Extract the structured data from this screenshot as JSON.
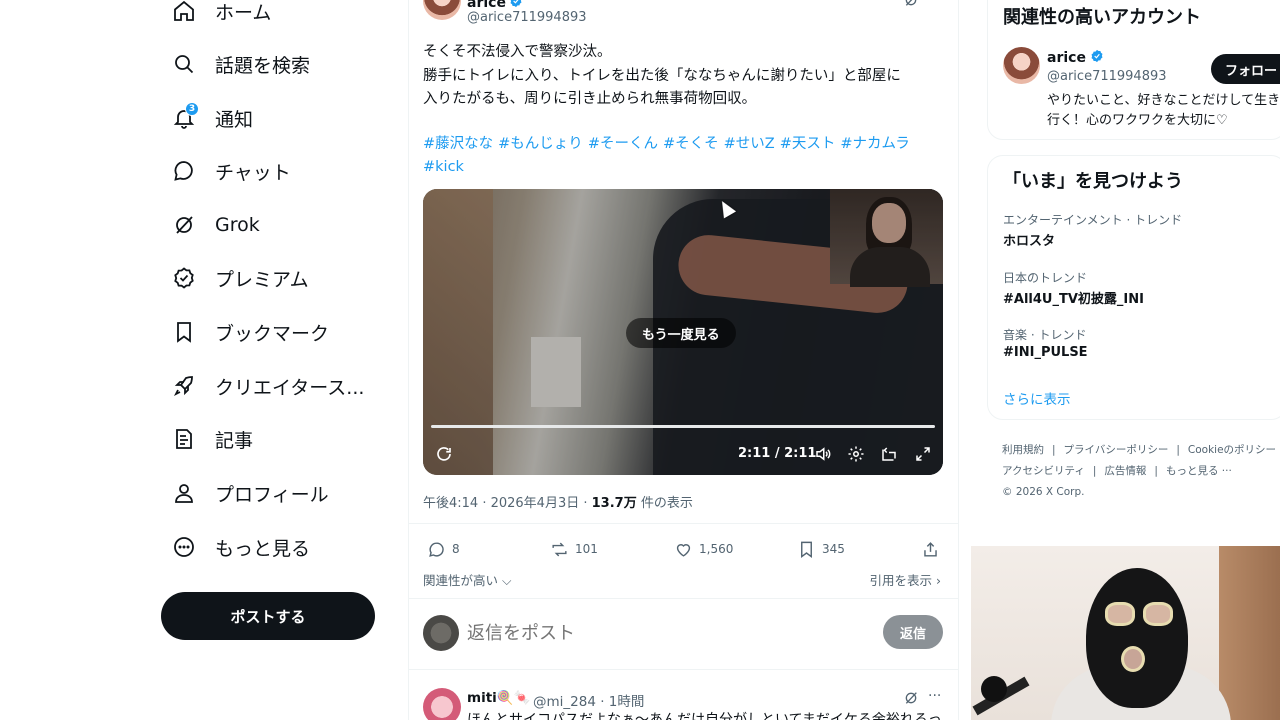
{
  "nav": {
    "items": [
      {
        "label": "ホーム",
        "icon": "home-icon"
      },
      {
        "label": "話題を検索",
        "icon": "search-icon"
      },
      {
        "label": "通知",
        "icon": "bell-icon",
        "badge": "3"
      },
      {
        "label": "チャット",
        "icon": "chat-icon"
      },
      {
        "label": "Grok",
        "icon": "grok-icon"
      },
      {
        "label": "プレミアム",
        "icon": "verified-icon"
      },
      {
        "label": "ブックマーク",
        "icon": "bookmark-icon"
      },
      {
        "label": "クリエイタース...",
        "icon": "rocket-icon"
      },
      {
        "label": "記事",
        "icon": "article-icon"
      },
      {
        "label": "プロフィール",
        "icon": "person-icon"
      },
      {
        "label": "もっと見る",
        "icon": "more-circle-icon"
      }
    ],
    "post_label": "ポストする"
  },
  "tweet": {
    "author_name": "arice",
    "author_handle": "@arice711994893",
    "text_lines": [
      "そくそ不法侵入で警察沙汰。",
      "勝手にトイレに入り、トイレを出た後「ななちゃんに謝りたい」と部屋に",
      "入りたがるも、周りに引き止められ無事荷物回収。"
    ],
    "hashtags": [
      "#藤沢なな",
      "#もんじょり",
      "#そーくん",
      "#そくそ",
      "#せいZ",
      "#天スト",
      "#ナカムラ",
      "#kick"
    ],
    "video": {
      "replay_label": "もう一度見る",
      "time": "2:11 / 2:11",
      "progress": 1.0
    },
    "meta_time": "午後4:14 · 2026年4月3日 · ",
    "views_count": "13.7万",
    "views_label": " 件の表示",
    "stats": {
      "replies": "8",
      "reposts": "101",
      "likes": "1,560",
      "bookmarks": "345"
    },
    "sort_label": "関連性が高い",
    "quotes_label": "引用を表示"
  },
  "reply_box": {
    "placeholder": "返信をポスト",
    "button_label": "返信"
  },
  "reply_tweet": {
    "name": "miti🍭🍬",
    "meta": "@mi_284 · 1時間",
    "text": "ほんとサイコパスだよなぁ〜あんだけ自分がしといてまだイケる余裕れるっ"
  },
  "sidebar": {
    "related_title": "関連性の高いアカウント",
    "suggestion": {
      "name": "arice",
      "handle": "@arice711994893",
      "follow_label": "フォロー",
      "bio": "やりたいこと、好きなことだけして生きて行く！心のワクワクを大切に♡"
    },
    "trends_title": "「いま」を見つけよう",
    "trends": [
      {
        "category": "エンターテインメント · トレンド",
        "name": "ホロスタ"
      },
      {
        "category": "日本のトレンド",
        "name": "#All4U_TV初披露_INI"
      },
      {
        "category": "音楽 · トレンド",
        "name": "#INI_PULSE"
      }
    ],
    "show_more": "さらに表示",
    "footer": {
      "links": [
        "利用規約",
        "プライバシーポリシー",
        "Cookieのポリシー",
        "アクセシビリティ",
        "広告情報",
        "もっと見る ···"
      ],
      "copyright": "© 2026 X Corp."
    }
  },
  "colors": {
    "accent": "#1d9bf0",
    "text": "#0f1419",
    "muted": "#536471"
  }
}
